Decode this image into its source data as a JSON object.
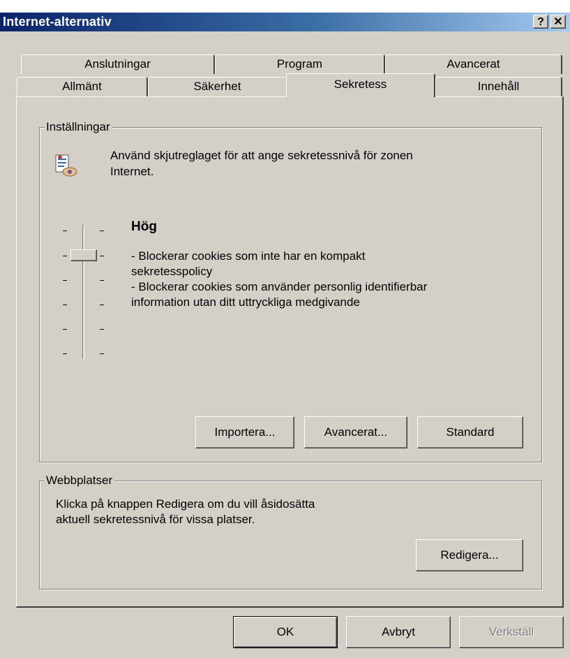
{
  "window": {
    "title": "Internet-alternativ",
    "help_glyph": "?",
    "close_glyph": "✕"
  },
  "tabs": {
    "row1": [
      "Anslutningar",
      "Program",
      "Avancerat"
    ],
    "row2": [
      "Allmänt",
      "Säkerhet",
      "Sekretess",
      "Innehåll"
    ],
    "active": "Sekretess"
  },
  "settings": {
    "legend": "Inställningar",
    "intro_line1": "Använd skjutreglaget för att ange sekretessnivå för zonen",
    "intro_line2": "Internet.",
    "level_title": "Hög",
    "level_fraction": 0.2,
    "desc_lines": [
      "- Blockerar cookies som inte har en kompakt",
      "sekretesspolicy",
      "- Blockerar cookies som använder personlig identifierbar",
      "information utan ditt uttryckliga medgivande"
    ],
    "buttons": {
      "import": "Importera...",
      "advanced": "Avancerat...",
      "default": "Standard"
    }
  },
  "sites": {
    "legend": "Webbplatser",
    "text_line1": "Klicka på knappen Redigera om du vill åsidosätta",
    "text_line2": "aktuell sekretessnivå för vissa platser.",
    "edit_button": "Redigera..."
  },
  "footer": {
    "ok": "OK",
    "cancel": "Avbryt",
    "apply": "Verkställ"
  },
  "colors": {
    "title_start": "#0a246a",
    "title_end": "#a6caf0",
    "face": "#d4d0c8"
  },
  "icons": {
    "privacy": "privacy-zone-icon",
    "help": "help-icon",
    "close": "close-icon"
  }
}
